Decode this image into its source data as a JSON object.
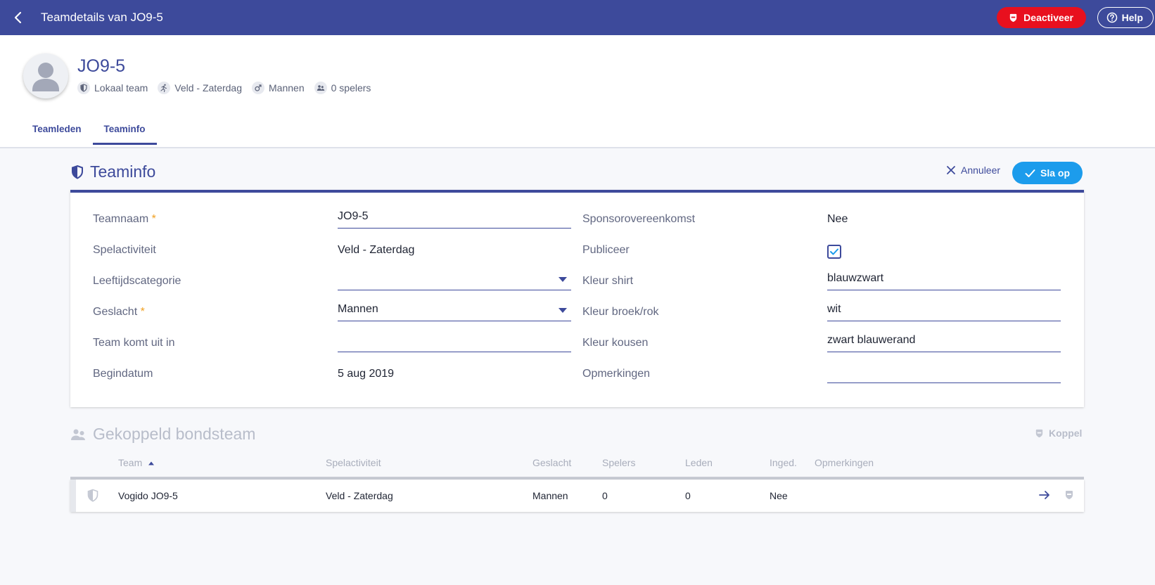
{
  "topbar": {
    "title": "Teamdetails van JO9-5",
    "deactivate_label": "Deactiveer",
    "help_label": "Help"
  },
  "team": {
    "name": "JO9-5",
    "meta": [
      {
        "icon": "shield-icon",
        "label": "Lokaal team"
      },
      {
        "icon": "running-icon",
        "label": "Veld - Zaterdag"
      },
      {
        "icon": "male-icon",
        "label": "Mannen"
      },
      {
        "icon": "players-icon",
        "label": "0 spelers"
      }
    ]
  },
  "tabs": [
    {
      "label": "Teamleden",
      "active": false
    },
    {
      "label": "Teaminfo",
      "active": true
    }
  ],
  "teaminfo": {
    "title": "Teaminfo",
    "cancel_label": "Annuleer",
    "save_label": "Sla op",
    "required_marker": "*",
    "left": [
      {
        "label": "Teamnaam",
        "required": true,
        "value": "JO9-5",
        "kind": "input"
      },
      {
        "label": "Spelactiviteit",
        "required": false,
        "value": "Veld - Zaterdag",
        "kind": "text"
      },
      {
        "label": "Leeftijdscategorie",
        "required": false,
        "value": "",
        "kind": "select"
      },
      {
        "label": "Geslacht",
        "required": true,
        "value": "Mannen",
        "kind": "select"
      },
      {
        "label": "Team komt uit in",
        "required": false,
        "value": "",
        "kind": "input"
      },
      {
        "label": "Begindatum",
        "required": false,
        "value": "5 aug 2019",
        "kind": "text"
      }
    ],
    "right": [
      {
        "label": "Sponsorovereenkomst",
        "value": "Nee",
        "kind": "text"
      },
      {
        "label": "Publiceer",
        "value": "",
        "kind": "checkbox",
        "checked": true
      },
      {
        "label": "Kleur shirt",
        "value": "blauwzwart",
        "kind": "input"
      },
      {
        "label": "Kleur broek/rok",
        "value": "wit",
        "kind": "input"
      },
      {
        "label": "Kleur kousen",
        "value": "zwart blauwerand",
        "kind": "input"
      },
      {
        "label": "Opmerkingen",
        "value": "",
        "kind": "input"
      }
    ]
  },
  "bondsteam": {
    "title": "Gekoppeld bondsteam",
    "koppel_label": "Koppel",
    "columns": [
      "Team",
      "Spelactiviteit",
      "Geslacht",
      "Spelers",
      "Leden",
      "Inged.",
      "Opmerkingen"
    ],
    "rows": [
      {
        "team": "Vogido JO9-5",
        "spelactiviteit": "Veld - Zaterdag",
        "geslacht": "Mannen",
        "spelers": "0",
        "leden": "0",
        "inged": "Nee",
        "opmerkingen": ""
      }
    ]
  },
  "colors": {
    "primary": "#3d4a9b",
    "danger": "#e8101e",
    "save": "#1c9cec",
    "required": "#f0a021"
  }
}
